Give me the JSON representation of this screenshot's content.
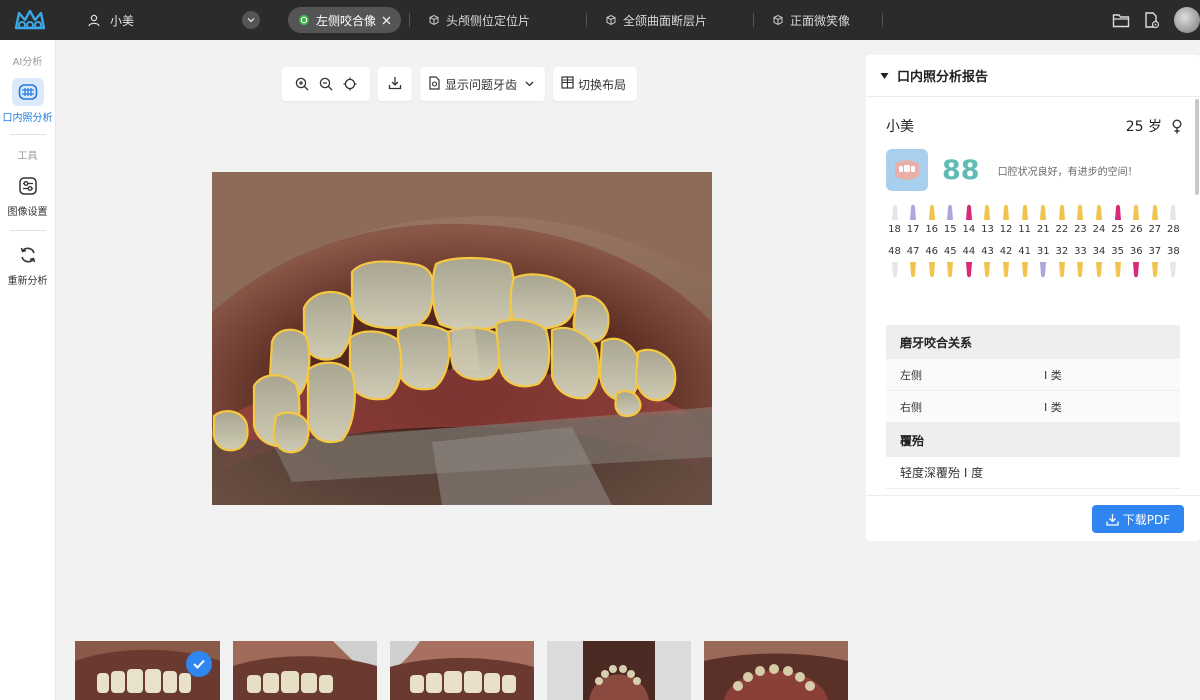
{
  "topbar": {
    "user_name": "小美",
    "tabs": [
      {
        "label": "左侧咬合像",
        "active": true
      },
      {
        "label": "头颅侧位定位片",
        "active": false
      },
      {
        "label": "全颌曲面断层片",
        "active": false
      },
      {
        "label": "正面微笑像",
        "active": false
      }
    ],
    "icons": [
      "folder-icon",
      "file-settings-icon",
      "avatar"
    ]
  },
  "sidebar": {
    "section_ai": "AI分析",
    "item_intraoral": "口内照分析",
    "section_tools": "工具",
    "item_image_settings": "图像设置",
    "item_reanalyze": "重新分析"
  },
  "toolbar": {
    "show_problem_teeth": "显示问题牙齿",
    "switch_layout": "切换布局"
  },
  "report": {
    "title": "口内照分析报告",
    "patient_name": "小美",
    "age": "25 岁",
    "score": "88",
    "summary": "口腔状况良好，有进步的空间！",
    "upper_teeth": [
      {
        "num": "18",
        "color": "#e6e6e6"
      },
      {
        "num": "17",
        "color": "#b4a4dc"
      },
      {
        "num": "16",
        "color": "#f0c44e"
      },
      {
        "num": "15",
        "color": "#b4a4dc"
      },
      {
        "num": "14",
        "color": "#d82a78"
      },
      {
        "num": "13",
        "color": "#f0c44e"
      },
      {
        "num": "12",
        "color": "#f0c44e"
      },
      {
        "num": "11",
        "color": "#f0c44e"
      },
      {
        "num": "21",
        "color": "#f0c44e"
      },
      {
        "num": "22",
        "color": "#f0c44e"
      },
      {
        "num": "23",
        "color": "#f0c44e"
      },
      {
        "num": "24",
        "color": "#f0c44e"
      },
      {
        "num": "25",
        "color": "#d82a78"
      },
      {
        "num": "26",
        "color": "#f0c44e"
      },
      {
        "num": "27",
        "color": "#f0c44e"
      },
      {
        "num": "28",
        "color": "#e6e6e6"
      }
    ],
    "lower_teeth": [
      {
        "num": "48",
        "color": "#e6e6e6"
      },
      {
        "num": "47",
        "color": "#f0c44e"
      },
      {
        "num": "46",
        "color": "#f0c44e"
      },
      {
        "num": "45",
        "color": "#f0c44e"
      },
      {
        "num": "44",
        "color": "#d82a78"
      },
      {
        "num": "43",
        "color": "#f0c44e"
      },
      {
        "num": "42",
        "color": "#f0c44e"
      },
      {
        "num": "41",
        "color": "#f0c44e"
      },
      {
        "num": "31",
        "color": "#b4a4dc"
      },
      {
        "num": "32",
        "color": "#f0c44e"
      },
      {
        "num": "33",
        "color": "#f0c44e"
      },
      {
        "num": "34",
        "color": "#f0c44e"
      },
      {
        "num": "35",
        "color": "#f0c44e"
      },
      {
        "num": "36",
        "color": "#d82a78"
      },
      {
        "num": "37",
        "color": "#f0c44e"
      },
      {
        "num": "38",
        "color": "#e6e6e6"
      }
    ],
    "occlusion": {
      "heading": "磨牙咬合关系",
      "rows": [
        {
          "k": "左侧",
          "v": "I 类"
        },
        {
          "k": "右侧",
          "v": "I 类"
        }
      ]
    },
    "overbite": {
      "heading": "覆殆",
      "value": "轻度深覆殆 I 度"
    },
    "download_pdf": "下载PDF"
  },
  "colors": {
    "accent": "#2f86f0",
    "score": "#5fbcb4",
    "topbar": "#2b2b2b",
    "outline": "#f5c842"
  }
}
